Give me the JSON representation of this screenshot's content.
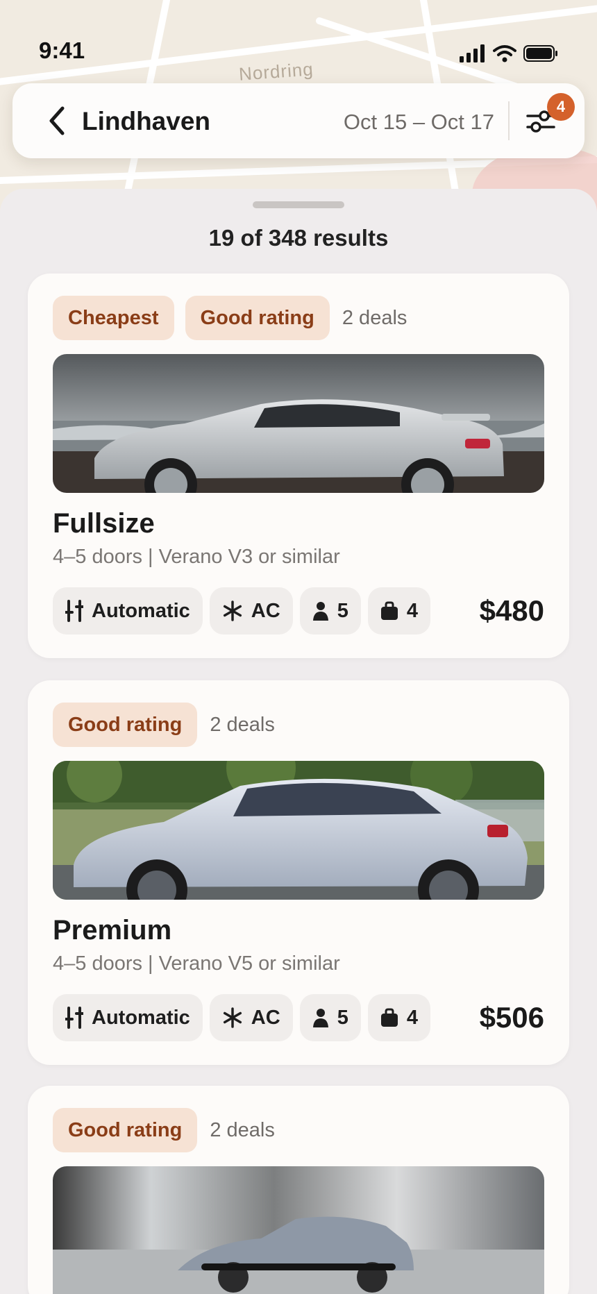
{
  "status_bar": {
    "time": "9:41"
  },
  "map": {
    "street_label": "Nordring"
  },
  "header": {
    "location": "Lindhaven",
    "dates": "Oct 15 – Oct 17",
    "filter_count": "4"
  },
  "results": {
    "summary": "19 of 348 results"
  },
  "cards": [
    {
      "tags": [
        "Cheapest",
        "Good rating"
      ],
      "deals": "2 deals",
      "name": "Fullsize",
      "description": "4–5 doors | Verano V3 or similar",
      "features": {
        "transmission": "Automatic",
        "ac": "AC",
        "seats": "5",
        "bags": "4"
      },
      "price": "$480"
    },
    {
      "tags": [
        "Good rating"
      ],
      "deals": "2 deals",
      "name": "Premium",
      "description": "4–5 doors | Verano V5 or similar",
      "features": {
        "transmission": "Automatic",
        "ac": "AC",
        "seats": "5",
        "bags": "4"
      },
      "price": "$506"
    },
    {
      "tags": [
        "Good rating"
      ],
      "deals": "2 deals"
    }
  ],
  "colors": {
    "accent": "#d4612b",
    "tag_bg": "#f6e2d4",
    "tag_text": "#8a3d17",
    "sheet_bg": "#efeced"
  }
}
